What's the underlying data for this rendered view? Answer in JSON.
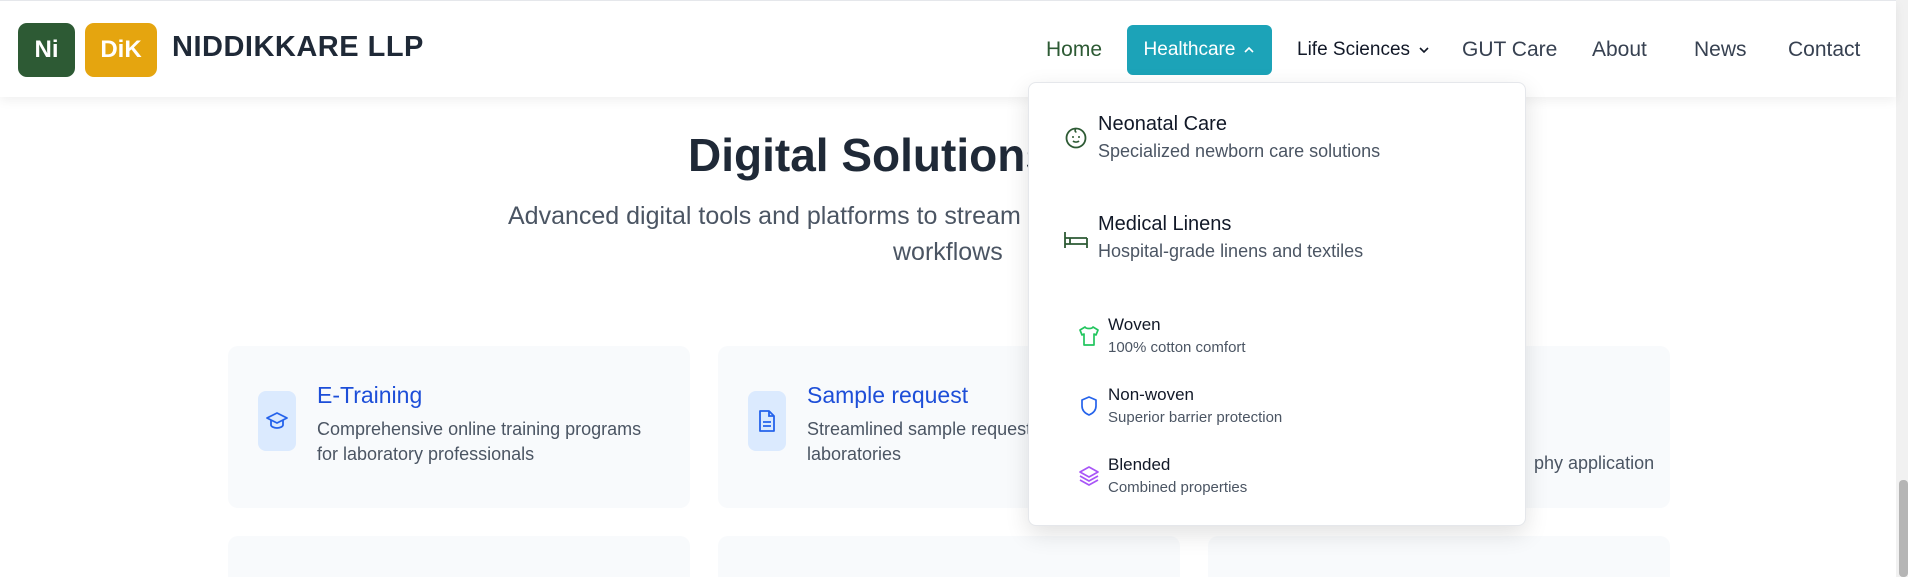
{
  "header": {
    "logo_ni": "Ni",
    "logo_dik": "DiK",
    "brand_name": "NIDDIKKARE LLP",
    "nav": {
      "home": "Home",
      "healthcare": "Healthcare",
      "life_sciences": "Life Sciences",
      "gut_care": "GUT Care",
      "about": "About",
      "news": "News",
      "contact": "Contact"
    }
  },
  "main": {
    "title": "Digital Solutions",
    "subtitle": "Advanced digital tools and platforms to stream... workflows",
    "subtitle_line1": "Advanced digital tools and platforms to stream",
    "subtitle_line2": "workflows",
    "cards": [
      {
        "title": "E-Training",
        "description": "Comprehensive online training programs for laboratory professionals",
        "icon": "graduation-cap-icon"
      },
      {
        "title": "Sample request",
        "description": "Streamlined sample request system for laboratories",
        "icon": "document-icon"
      },
      {
        "title": "",
        "description": "phy application",
        "icon": ""
      }
    ]
  },
  "dropdown": {
    "items": [
      {
        "title": "Neonatal Care",
        "description": "Specialized newborn care solutions",
        "icon": "baby-face-icon"
      },
      {
        "title": "Medical Linens",
        "description": "Hospital-grade linens and textiles",
        "icon": "bed-icon"
      }
    ],
    "sub_items": [
      {
        "title": "Woven",
        "description": "100% cotton comfort",
        "icon": "shirt-icon"
      },
      {
        "title": "Non-woven",
        "description": "Superior barrier protection",
        "icon": "shield-icon"
      },
      {
        "title": "Blended",
        "description": "Combined properties",
        "icon": "layers-icon"
      }
    ]
  },
  "colors": {
    "brand_green": "#2d5a34",
    "brand_gold": "#e5a50f",
    "nav_active": "#1ca3b8",
    "link_blue": "#1d4ed8"
  }
}
